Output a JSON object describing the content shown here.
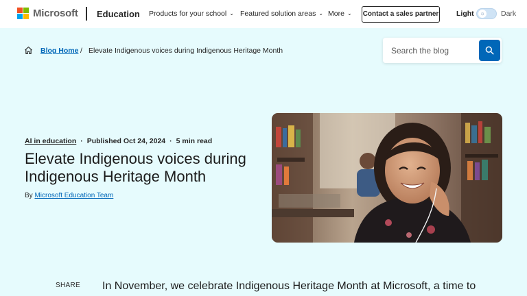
{
  "header": {
    "logo_text": "Microsoft",
    "brand": "Education",
    "nav": [
      {
        "label": "Products for your school"
      },
      {
        "label": "Featured solution areas"
      },
      {
        "label": "More"
      }
    ],
    "cta_label": "Contact a sales partner",
    "theme": {
      "light_label": "Light",
      "dark_label": "Dark",
      "selected": "Light"
    },
    "logo_colors": [
      "#f25022",
      "#7fba00",
      "#00a4ef",
      "#ffb900"
    ]
  },
  "breadcrumb": {
    "home_icon": "home-icon",
    "parent_label": "Blog Home",
    "separator": "/",
    "current_label": "Elevate Indigenous voices during Indigenous Heritage Month"
  },
  "search": {
    "placeholder": "Search the blog",
    "value": "",
    "button_icon": "search-icon"
  },
  "article": {
    "category": "AI in education",
    "published": "Published Oct 24, 2024",
    "read_time": "5 min read",
    "title": "Elevate Indigenous voices during Indigenous Heritage Month",
    "byline_prefix": "By",
    "author": "Microsoft Education Team",
    "share_label": "SHARE",
    "lede": "In November, we celebrate Indigenous Heritage Month at Microsoft, a time to"
  },
  "colors": {
    "page_bg": "#e6fbfd",
    "accent": "#0067b8",
    "text": "#1b1b1b"
  }
}
